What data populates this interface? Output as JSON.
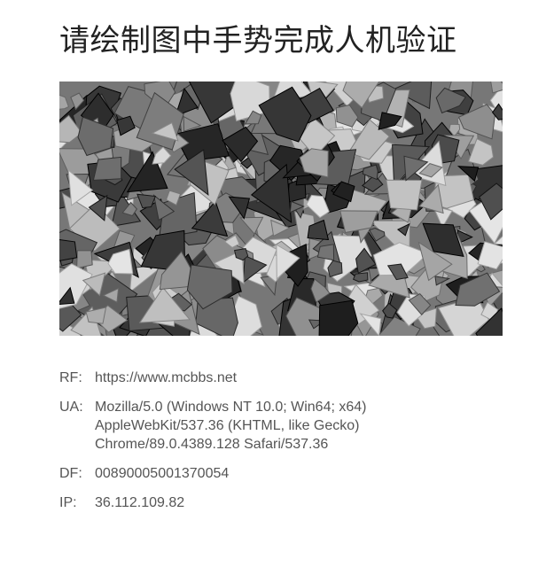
{
  "page": {
    "title": "请绘制图中手势完成人机验证"
  },
  "captcha": {
    "image_description": "captcha-noise-image"
  },
  "info": [
    {
      "label": "RF:",
      "value": "https://www.mcbbs.net"
    },
    {
      "label": "UA:",
      "value": "Mozilla/5.0 (Windows NT 10.0; Win64; x64)\nAppleWebKit/537.36 (KHTML, like Gecko)\nChrome/89.0.4389.128 Safari/537.36"
    },
    {
      "label": "DF:",
      "value": "00890005001370054"
    },
    {
      "label": "IP:",
      "value": "36.112.109.82"
    }
  ]
}
